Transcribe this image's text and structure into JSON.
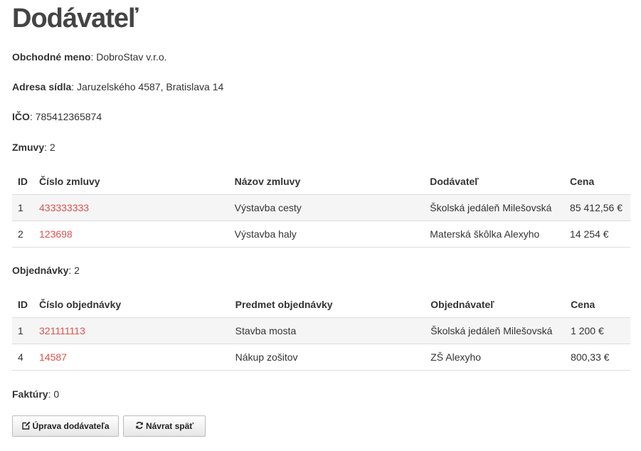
{
  "title": "Dodávateľ",
  "fields": {
    "name_label": "Obchodné meno",
    "name_value": "DobroStav v.r.o.",
    "address_label": "Adresa sídla",
    "address_value": "Jaruzelského 4587, Bratislava 14",
    "ico_label": "IČO",
    "ico_value": "785412365874"
  },
  "contracts": {
    "label": "Zmuvy",
    "count": "2",
    "headers": [
      "ID",
      "Číslo zmluvy",
      "Názov zmluvy",
      "Dodávateľ",
      "Cena"
    ],
    "rows": [
      {
        "id": "1",
        "number": "433333333",
        "name": "Výstavba cesty",
        "party": "Školská jedáleň Milešovská",
        "price": "85 412,56 €"
      },
      {
        "id": "2",
        "number": "123698",
        "name": "Výstavba haly",
        "party": "Materská škôlka Alexyho",
        "price": "14 254 €"
      }
    ]
  },
  "orders": {
    "label": "Objednávky",
    "count": "2",
    "headers": [
      "ID",
      "Číslo objednávky",
      "Predmet objednávky",
      "Objednávateľ",
      "Cena"
    ],
    "rows": [
      {
        "id": "1",
        "number": "321111113",
        "name": "Stavba mosta",
        "party": "Školská jedáleň Milešovská",
        "price": "1 200 €"
      },
      {
        "id": "4",
        "number": "14587",
        "name": "Nákup zošitov",
        "party": "ZŠ Alexyho",
        "price": "800,33 €"
      }
    ]
  },
  "invoices": {
    "label": "Faktúry",
    "count": "0"
  },
  "buttons": {
    "edit_label": "Úprava dodávateľa",
    "edit_icon": "edit-icon",
    "back_label": "Návrat späť",
    "back_icon": "refresh-icon"
  },
  "colors": {
    "link": "#d9534f",
    "heading": "#444444",
    "stripe": "#f5f5f5"
  }
}
